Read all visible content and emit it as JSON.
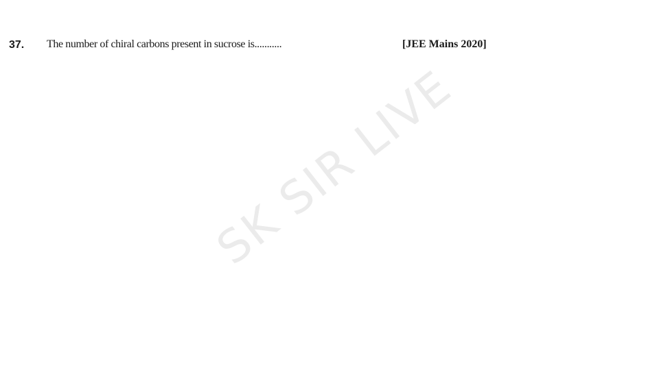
{
  "question": {
    "number": "37.",
    "text": "The number of chiral carbons present in sucrose is...........",
    "source": "[JEE Mains 2020]"
  },
  "watermark": {
    "text": "SK SIR LIVE",
    "color": "#ebebeb"
  }
}
